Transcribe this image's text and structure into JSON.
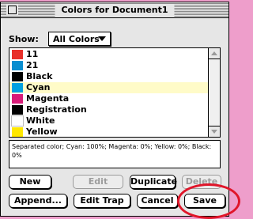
{
  "window": {
    "title": "Colors for Document1"
  },
  "show": {
    "label": "Show:",
    "selected": "All Colors"
  },
  "colors": [
    {
      "name": "11",
      "swatch": "#e8302a",
      "selected": false
    },
    {
      "name": "21",
      "swatch": "#0a8ed0",
      "selected": false
    },
    {
      "name": "Black",
      "swatch": "#000000",
      "selected": false
    },
    {
      "name": "Cyan",
      "swatch": "#00a0e0",
      "selected": true
    },
    {
      "name": "Magenta",
      "swatch": "#d81b78",
      "selected": false
    },
    {
      "name": "Registration",
      "swatch": "#000000",
      "selected": false
    },
    {
      "name": "White",
      "swatch": "#ffffff",
      "selected": false
    },
    {
      "name": "Yellow",
      "swatch": "#ffe800",
      "selected": false
    }
  ],
  "description": "Separated color; Cyan: 100%; Magenta: 0%; Yellow: 0%; Black: 0%",
  "buttons": {
    "new": "New",
    "edit": "Edit",
    "duplicate": "Duplicate",
    "delete": "Delete",
    "append": "Append...",
    "edit_trap": "Edit Trap",
    "cancel": "Cancel",
    "save": "Save"
  },
  "accent_colors": {
    "selection_row": "#fffbc8",
    "annotation_circle": "#e0162a",
    "background": "#ee9ecb"
  }
}
